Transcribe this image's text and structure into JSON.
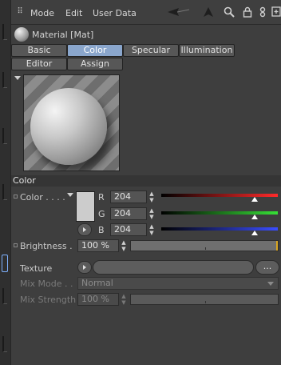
{
  "menubar": {
    "items": [
      "Mode",
      "Edit",
      "User Data"
    ],
    "tools": [
      "back-arrow-icon",
      "cursor-icon",
      "search-icon",
      "lock-icon",
      "link-icon",
      "add-panel-icon"
    ]
  },
  "material": {
    "title": "Material [Mat]"
  },
  "tabs": {
    "row1": [
      "Basic",
      "Color",
      "Specular",
      "Illumination"
    ],
    "row2": [
      "Editor",
      "Assign"
    ],
    "active": "Color"
  },
  "section": {
    "title": "Color"
  },
  "color": {
    "label": "Color . . . .",
    "swatch_color": "#cccccc",
    "channels": [
      {
        "name": "R",
        "value": "204",
        "fraction": 0.8,
        "color": "#ff2a2a"
      },
      {
        "name": "G",
        "value": "204",
        "fraction": 0.8,
        "color": "#36e036"
      },
      {
        "name": "B",
        "value": "204",
        "fraction": 0.8,
        "color": "#3a4dff"
      }
    ]
  },
  "brightness": {
    "label": "Brightness .",
    "value": "100 %",
    "fraction": 1.0
  },
  "texture": {
    "label": "Texture",
    "more_label": "..."
  },
  "mix_mode": {
    "label": "Mix Mode . .",
    "value": "Normal"
  },
  "mix_strength": {
    "label": "Mix Strength",
    "value": "100 %"
  },
  "colors": {
    "accent_tab": "#8aa6cc",
    "background": "#3e3e3e"
  }
}
